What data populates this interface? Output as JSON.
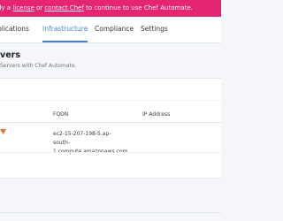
{
  "banner": {
    "text_before": "dy a ",
    "license_link": "license",
    "text_mid": " or ",
    "contact_link": "contact Chef",
    "text_after": " to continue to use Chef Automate."
  },
  "nav": {
    "items": [
      {
        "label": "plications"
      },
      {
        "label": "Infrastructure"
      },
      {
        "label": "Compliance"
      },
      {
        "label": "Settings"
      }
    ],
    "active": "Infrastructure"
  },
  "page": {
    "title": "vers",
    "subtitle": "Servers with Chef Automate."
  },
  "table": {
    "headers": {
      "fqdn": "FQDN",
      "ip": "IP Address"
    },
    "rows": [
      {
        "fqdn": "ec2-15-207-198-5.ap-south-1.compute.amazonaws.com",
        "ip": ""
      }
    ]
  },
  "colors": {
    "banner": "#e5256f",
    "accent": "#4a7fc4",
    "status": "#e8742a"
  }
}
